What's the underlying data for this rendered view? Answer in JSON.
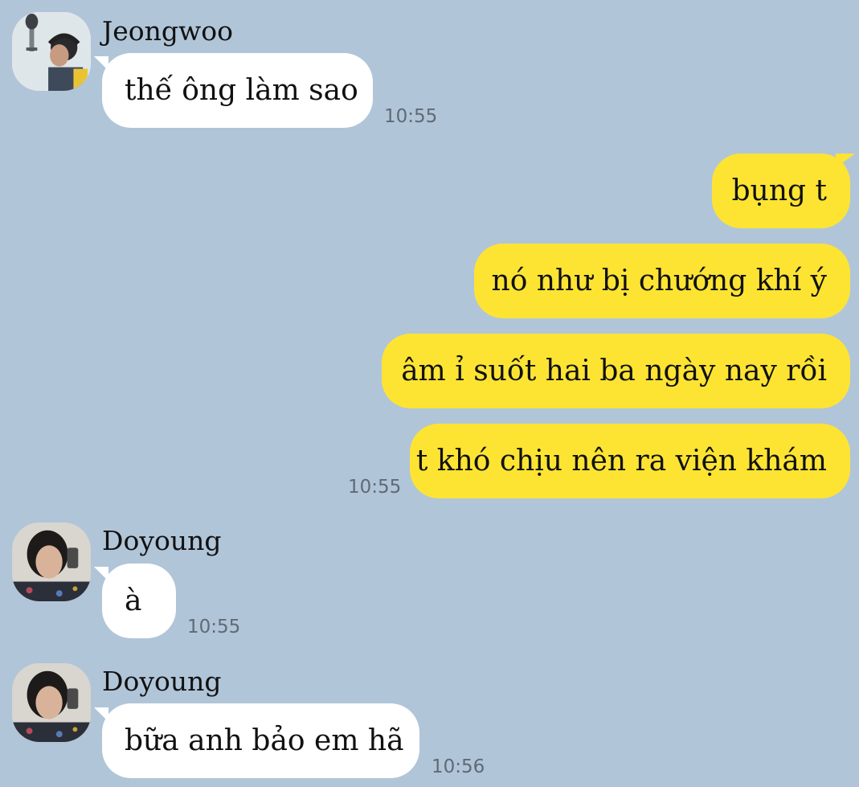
{
  "colors": {
    "background": "#b1c5d9",
    "incoming_bubble": "#ffffff",
    "outgoing_bubble": "#fde433",
    "timestamp": "#5f6a75"
  },
  "messages": {
    "m1": {
      "sender": "Jeongwoo",
      "avatar": "jeongwoo-avatar-photo",
      "text": "thế ông làm sao",
      "time": "10:55"
    },
    "m2": {
      "text": "bụng t"
    },
    "m3": {
      "text": "nó như bị chướng khí ý"
    },
    "m4": {
      "text": "âm ỉ suốt hai ba ngày nay rồi"
    },
    "m5": {
      "text": "t khó chịu nên ra viện khám",
      "time": "10:55"
    },
    "m6": {
      "sender": "Doyoung",
      "avatar": "doyoung-avatar-photo",
      "text": "à",
      "time": "10:55"
    },
    "m7": {
      "sender": "Doyoung",
      "avatar": "doyoung-avatar-photo",
      "text": "bữa anh bảo em hã",
      "time": "10:56"
    }
  }
}
